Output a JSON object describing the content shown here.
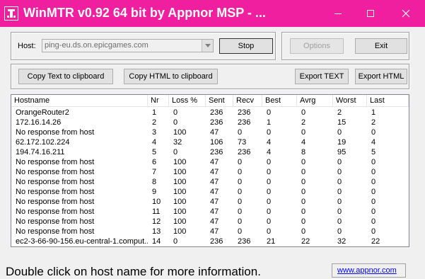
{
  "window": {
    "title": "WinMTR v0.92 64 bit by Appnor MSP - ..."
  },
  "host": {
    "label": "Host:",
    "value": "ping-eu.ds.on.epicgames.com"
  },
  "buttons": {
    "stop": "Stop",
    "options": "Options",
    "exit": "Exit",
    "copy_text": "Copy Text to clipboard",
    "copy_html": "Copy HTML to clipboard",
    "export_text": "Export TEXT",
    "export_html": "Export HTML"
  },
  "table": {
    "columns": [
      "Hostname",
      "Nr",
      "Loss %",
      "Sent",
      "Recv",
      "Best",
      "Avrg",
      "Worst",
      "Last"
    ],
    "rows": [
      [
        "OrangeRouter2",
        "1",
        "0",
        "236",
        "236",
        "0",
        "0",
        "2",
        "1"
      ],
      [
        "172.16.14.26",
        "2",
        "0",
        "236",
        "236",
        "1",
        "2",
        "15",
        "2"
      ],
      [
        "No response from host",
        "3",
        "100",
        "47",
        "0",
        "0",
        "0",
        "0",
        "0"
      ],
      [
        "62.172.102.224",
        "4",
        "32",
        "106",
        "73",
        "4",
        "4",
        "19",
        "4"
      ],
      [
        "194.74.16.211",
        "5",
        "0",
        "236",
        "236",
        "4",
        "8",
        "95",
        "5"
      ],
      [
        "No response from host",
        "6",
        "100",
        "47",
        "0",
        "0",
        "0",
        "0",
        "0"
      ],
      [
        "No response from host",
        "7",
        "100",
        "47",
        "0",
        "0",
        "0",
        "0",
        "0"
      ],
      [
        "No response from host",
        "8",
        "100",
        "47",
        "0",
        "0",
        "0",
        "0",
        "0"
      ],
      [
        "No response from host",
        "9",
        "100",
        "47",
        "0",
        "0",
        "0",
        "0",
        "0"
      ],
      [
        "No response from host",
        "10",
        "100",
        "47",
        "0",
        "0",
        "0",
        "0",
        "0"
      ],
      [
        "No response from host",
        "11",
        "100",
        "47",
        "0",
        "0",
        "0",
        "0",
        "0"
      ],
      [
        "No response from host",
        "12",
        "100",
        "47",
        "0",
        "0",
        "0",
        "0",
        "0"
      ],
      [
        "No response from host",
        "13",
        "100",
        "47",
        "0",
        "0",
        "0",
        "0",
        "0"
      ],
      [
        "ec2-3-66-90-156.eu-central-1.comput...",
        "14",
        "0",
        "236",
        "236",
        "21",
        "22",
        "32",
        "22"
      ]
    ]
  },
  "status": {
    "text": "Double click on host name for more information.",
    "link": "www.appnor.com"
  },
  "colors": {
    "titlebar": "#ef1fa0",
    "link": "#0000ff"
  },
  "icons": [
    "app-icon",
    "minimize-icon",
    "maximize-icon",
    "close-icon",
    "dropdown-arrow-icon"
  ]
}
